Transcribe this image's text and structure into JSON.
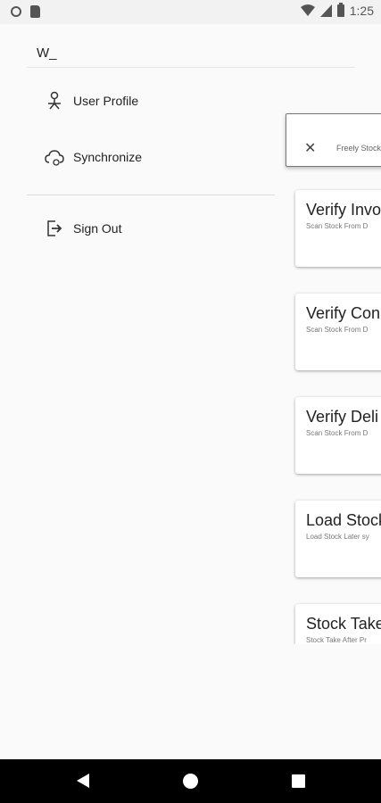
{
  "status_bar": {
    "time": "1:25"
  },
  "drawer": {
    "user_name": "W_",
    "items": [
      {
        "label": "User Profile",
        "icon": "user-profile-icon"
      },
      {
        "label": "Synchronize",
        "icon": "cloud-sync-icon"
      },
      {
        "label": "Sign Out",
        "icon": "sign-out-icon"
      }
    ]
  },
  "banner": {
    "text": "Freely Stock"
  },
  "cards": [
    {
      "title": "Verify Invo",
      "subtitle": "Scan Stock From D"
    },
    {
      "title": "Verify Con",
      "subtitle": "Scan Stock From D"
    },
    {
      "title": "Verify Deli",
      "subtitle": "Scan Stock From D"
    },
    {
      "title": "Load Stock",
      "subtitle": "Load Stock Later sy"
    },
    {
      "title": "Stock Take",
      "subtitle": "Stock Take After Pr"
    }
  ]
}
